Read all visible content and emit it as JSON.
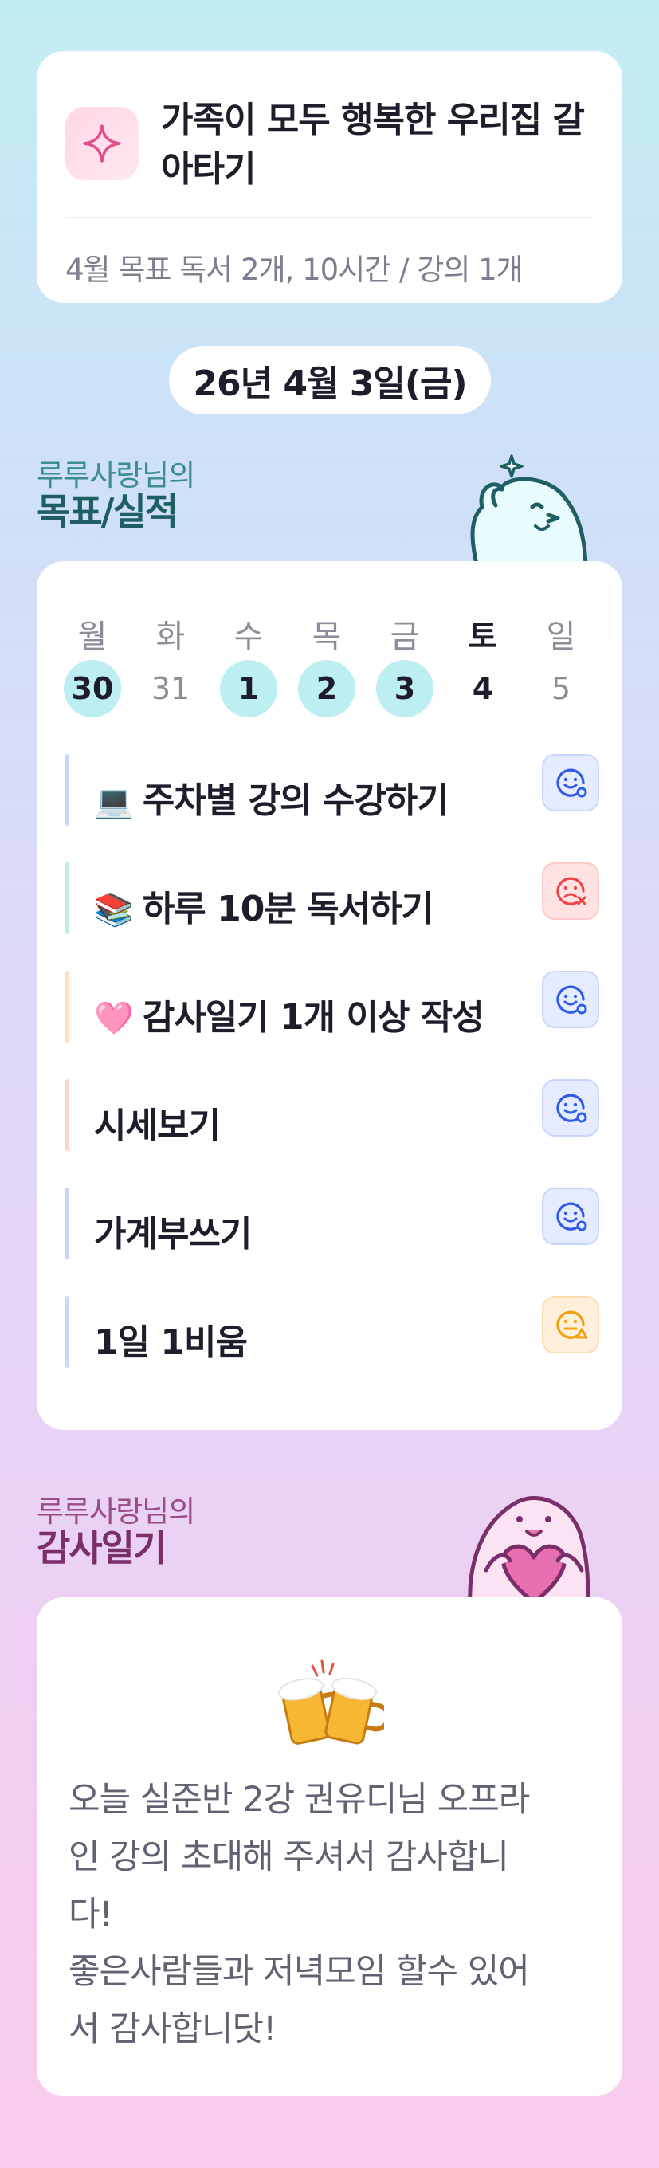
{
  "goal": {
    "title": "가족이 모두 행복한 우리집 갈아타기",
    "subtitle": "4월 목표  독서 2개, 10시간 / 강의 1개",
    "icon": "sparkle-icon"
  },
  "date": "26년 4월 3일(금)",
  "tracker_section": {
    "user": "루루사랑님의",
    "title": "목표/실적"
  },
  "week": [
    {
      "label": "월",
      "num": "30",
      "done": true
    },
    {
      "label": "화",
      "num": "31",
      "done": false
    },
    {
      "label": "수",
      "num": "1",
      "done": true
    },
    {
      "label": "목",
      "num": "2",
      "done": true
    },
    {
      "label": "금",
      "num": "3",
      "done": true
    },
    {
      "label": "토",
      "num": "4",
      "done": false
    },
    {
      "label": "일",
      "num": "5",
      "done": false
    }
  ],
  "tasks": [
    {
      "emoji": "💻",
      "text": "주차별 강의 수강하기",
      "status": "good",
      "bar": "#c9d6ff"
    },
    {
      "emoji": "📚",
      "text": "하루 10분 독서하기",
      "status": "bad",
      "bar": "#bff0d8"
    },
    {
      "emoji": "🩷",
      "text": "감사일기 1개 이상 작성",
      "status": "good",
      "bar": "#ffe0bf"
    },
    {
      "emoji": "",
      "text": "시세보기",
      "status": "good",
      "bar": "#ffd3d3"
    },
    {
      "emoji": "",
      "text": "가계부쓰기",
      "status": "good",
      "bar": "#c9d6ff"
    },
    {
      "emoji": "",
      "text": "1일 1비움",
      "status": "meh",
      "bar": "#c9d6ff"
    }
  ],
  "diary_section": {
    "user": "루루사랑님의",
    "title": "감사일기"
  },
  "diary": {
    "icon": "beer-mugs-icon",
    "text": "오늘 실준반 2강 권유디님 오프라\n인 강의 초대해 주셔서 감사합니\n다!\n좋은사람들과 저녁모임 할수 있어\n서 감사합니닷!"
  },
  "colors": {
    "done_day": "#bdeef2",
    "good": "#2f5bea",
    "bad": "#ef4444",
    "meh": "#f59e0b"
  }
}
